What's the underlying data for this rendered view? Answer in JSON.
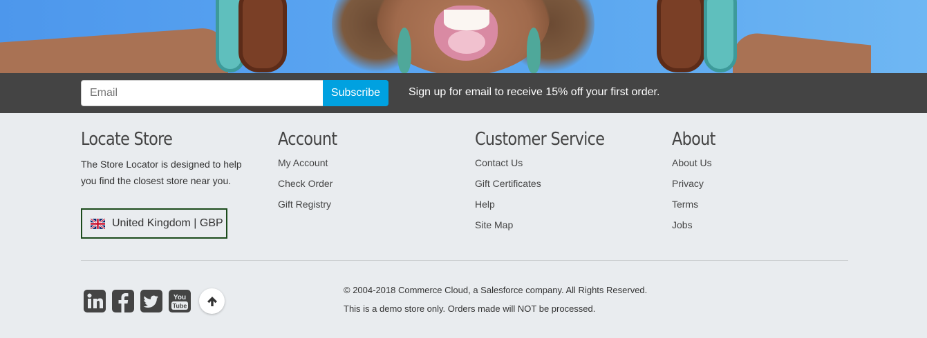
{
  "signup": {
    "email_placeholder": "Email",
    "subscribe_label": "Subscribe",
    "promo_text": "Sign up for email to receive 15% off your first order."
  },
  "footer": {
    "locate_store": {
      "title": "Locate Store",
      "description": "The Store Locator is designed to help you find the closest store near you."
    },
    "account": {
      "title": "Account",
      "links": [
        "My Account",
        "Check Order",
        "Gift Registry"
      ]
    },
    "customer_service": {
      "title": "Customer Service",
      "links": [
        "Contact Us",
        "Gift Certificates",
        "Help",
        "Site Map"
      ]
    },
    "about": {
      "title": "About",
      "links": [
        "About Us",
        "Privacy",
        "Terms",
        "Jobs"
      ]
    },
    "country_selector": {
      "label": "United Kingdom | GBP",
      "flag_icon": "uk-flag-icon"
    },
    "social_icons": [
      "linkedin-icon",
      "facebook-icon",
      "twitter-icon",
      "youtube-icon"
    ],
    "back_to_top_icon": "arrow-up-icon",
    "copyright": "© 2004-2018 Commerce Cloud, a Salesforce company. All Rights Reserved.",
    "demo_notice": "This is a demo store only. Orders made will NOT be processed."
  },
  "colors": {
    "signup_bar": "#444444",
    "subscribe_button": "#00a1e0",
    "footer_background": "#e9ecef",
    "country_border": "#1b4b1b",
    "social_icon": "#444444"
  }
}
